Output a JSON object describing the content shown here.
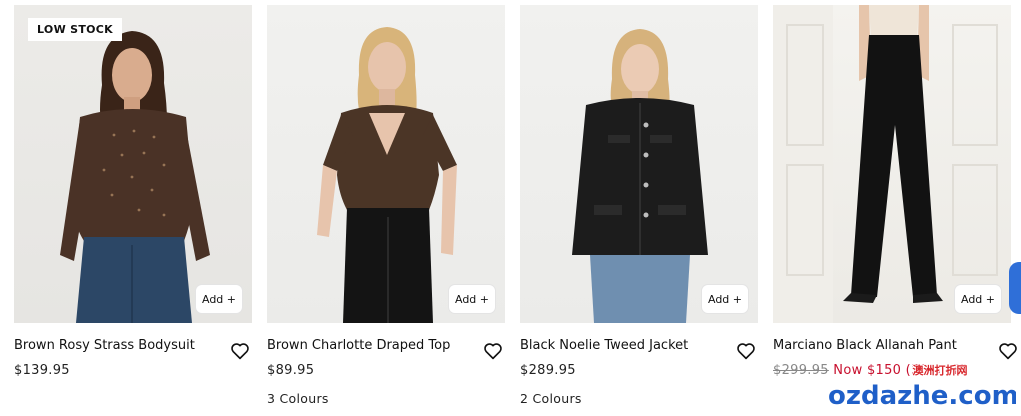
{
  "products": [
    {
      "name": "Brown Rosy Strass Bodysuit",
      "price": "$139.95",
      "colours": "",
      "badge": "LOW STOCK",
      "add_label": "Add +",
      "image_alt": "Model wearing brown sparkly bodysuit with blue jeans"
    },
    {
      "name": "Brown Charlotte Draped Top",
      "price": "$89.95",
      "colours": "3 Colours",
      "badge": "",
      "add_label": "Add +",
      "image_alt": "Model wearing brown draped top with black jeans"
    },
    {
      "name": "Black Noelie Tweed Jacket",
      "price": "$289.95",
      "colours": "2 Colours",
      "badge": "",
      "add_label": "Add +",
      "image_alt": "Model wearing black tweed jacket"
    },
    {
      "name": "Marciano Black Allanah Pant",
      "was_price": "$299.95",
      "now_price": "Now $150 (50% off)",
      "colours": "",
      "badge": "",
      "add_label": "Add +",
      "image_alt": "Model wearing black flared pants"
    }
  ],
  "watermark": {
    "brand": "ozdazhe.com",
    "subtitle": "澳洲打折网"
  },
  "colors": {
    "sale": "#c8102e",
    "watermark_blue": "#1f5fc8",
    "watermark_red": "#d8262b"
  }
}
